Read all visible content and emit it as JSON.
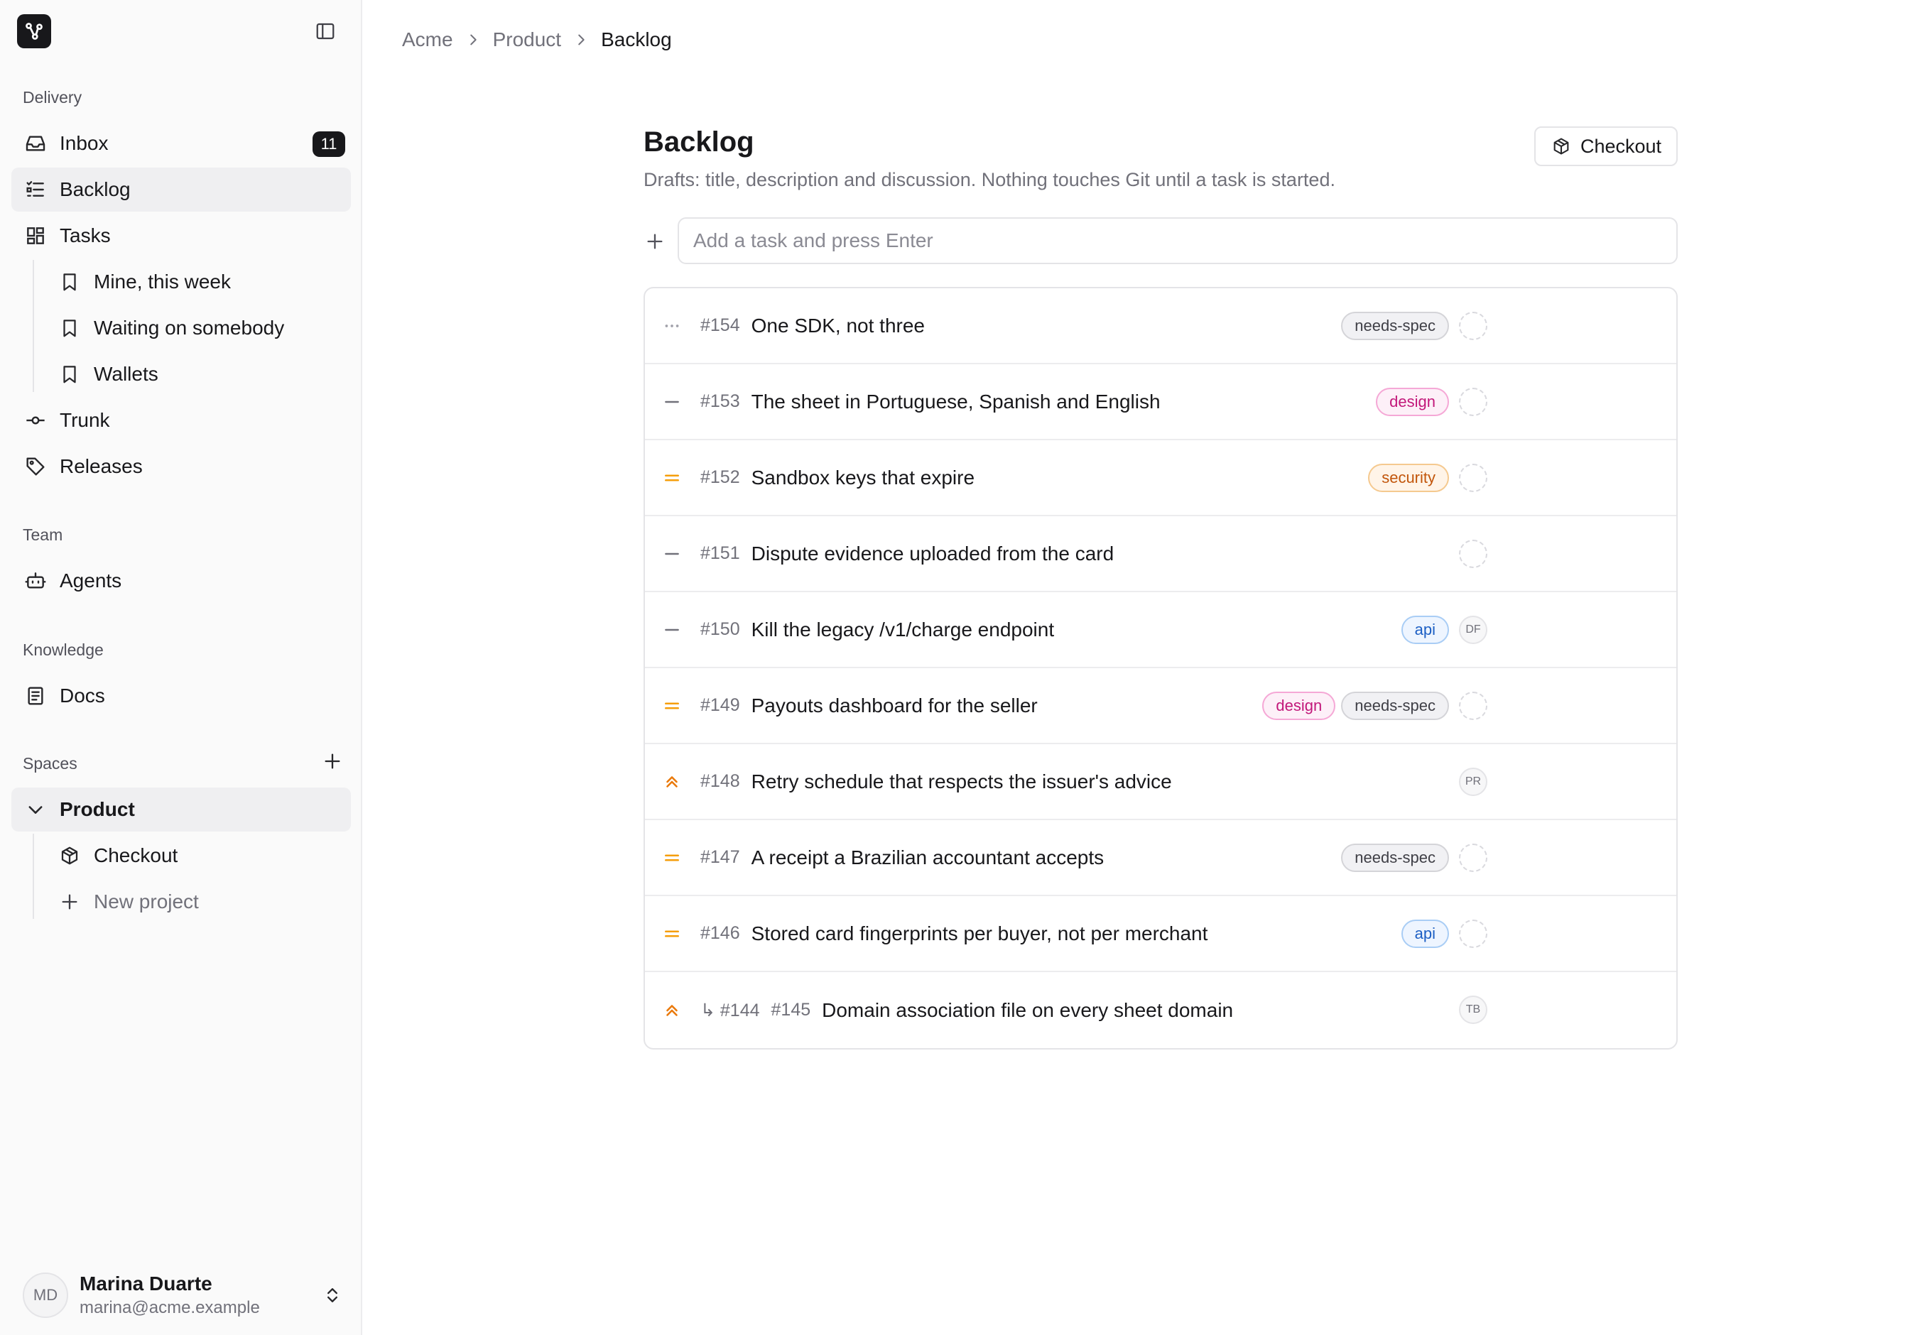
{
  "colors": {
    "accent": "#18181b",
    "priority_medium": "#f59e0b",
    "priority_high": "#ea7a0c",
    "muted": "#71717a"
  },
  "sidebar": {
    "logo_icon": "branch-logo-icon",
    "collapse_icon": "sidebar-toggle-icon",
    "sections": {
      "delivery": "Delivery",
      "team": "Team",
      "knowledge": "Knowledge",
      "spaces": "Spaces"
    },
    "items": {
      "inbox": {
        "label": "Inbox",
        "badge": "11",
        "icon": "inbox-icon"
      },
      "backlog": {
        "label": "Backlog",
        "icon": "list-icon"
      },
      "tasks": {
        "label": "Tasks",
        "icon": "grid-icon"
      },
      "mine_this_week": {
        "label": "Mine, this week",
        "icon": "bookmark-icon"
      },
      "waiting_on_somebody": {
        "label": "Waiting on somebody",
        "icon": "bookmark-icon"
      },
      "wallets": {
        "label": "Wallets",
        "icon": "bookmark-icon"
      },
      "trunk": {
        "label": "Trunk",
        "icon": "commit-icon"
      },
      "releases": {
        "label": "Releases",
        "icon": "tag-icon"
      },
      "agents": {
        "label": "Agents",
        "icon": "bot-icon"
      },
      "docs": {
        "label": "Docs",
        "icon": "document-icon"
      },
      "product": {
        "label": "Product",
        "icon": "chevron-down-icon"
      },
      "checkout": {
        "label": "Checkout",
        "icon": "package-icon"
      },
      "new_project": {
        "label": "New project",
        "icon": "plus-icon"
      }
    },
    "user": {
      "initials": "MD",
      "name": "Marina Duarte",
      "email": "marina@acme.example"
    }
  },
  "breadcrumb": [
    "Acme",
    "Product",
    "Backlog"
  ],
  "page": {
    "title": "Backlog",
    "subtitle": "Drafts: title, description and discussion. Nothing touches Git until a task is started.",
    "checkout_button": "Checkout",
    "add_task_placeholder": "Add a task and press Enter"
  },
  "tasks": [
    {
      "id": "#154",
      "title": "One SDK, not three",
      "priority": "none",
      "labels": [
        {
          "text": "needs-spec",
          "kind": "needs-spec"
        }
      ],
      "assignee": ""
    },
    {
      "id": "#153",
      "title": "The sheet in Portuguese, Spanish and English",
      "priority": "low",
      "labels": [
        {
          "text": "design",
          "kind": "design"
        }
      ],
      "assignee": ""
    },
    {
      "id": "#152",
      "title": "Sandbox keys that expire",
      "priority": "medium",
      "labels": [
        {
          "text": "security",
          "kind": "security"
        }
      ],
      "assignee": ""
    },
    {
      "id": "#151",
      "title": "Dispute evidence uploaded from the card",
      "priority": "low",
      "labels": [],
      "assignee": ""
    },
    {
      "id": "#150",
      "title": "Kill the legacy /v1/charge endpoint",
      "priority": "low",
      "labels": [
        {
          "text": "api",
          "kind": "api"
        }
      ],
      "assignee": "DF"
    },
    {
      "id": "#149",
      "title": "Payouts dashboard for the seller",
      "priority": "medium",
      "labels": [
        {
          "text": "design",
          "kind": "design"
        },
        {
          "text": "needs-spec",
          "kind": "needs-spec"
        }
      ],
      "assignee": ""
    },
    {
      "id": "#148",
      "title": "Retry schedule that respects the issuer's advice",
      "priority": "high",
      "labels": [],
      "assignee": "PR"
    },
    {
      "id": "#147",
      "title": "A receipt a Brazilian accountant accepts",
      "priority": "medium",
      "labels": [
        {
          "text": "needs-spec",
          "kind": "needs-spec"
        }
      ],
      "assignee": ""
    },
    {
      "id": "#146",
      "title": "Stored card fingerprints per buyer, not per merchant",
      "priority": "medium",
      "labels": [
        {
          "text": "api",
          "kind": "api"
        }
      ],
      "assignee": ""
    },
    {
      "id": "#145",
      "parent": "↳ #144",
      "title": "Domain association file on every sheet domain",
      "priority": "high",
      "labels": [],
      "assignee": "TB"
    }
  ]
}
